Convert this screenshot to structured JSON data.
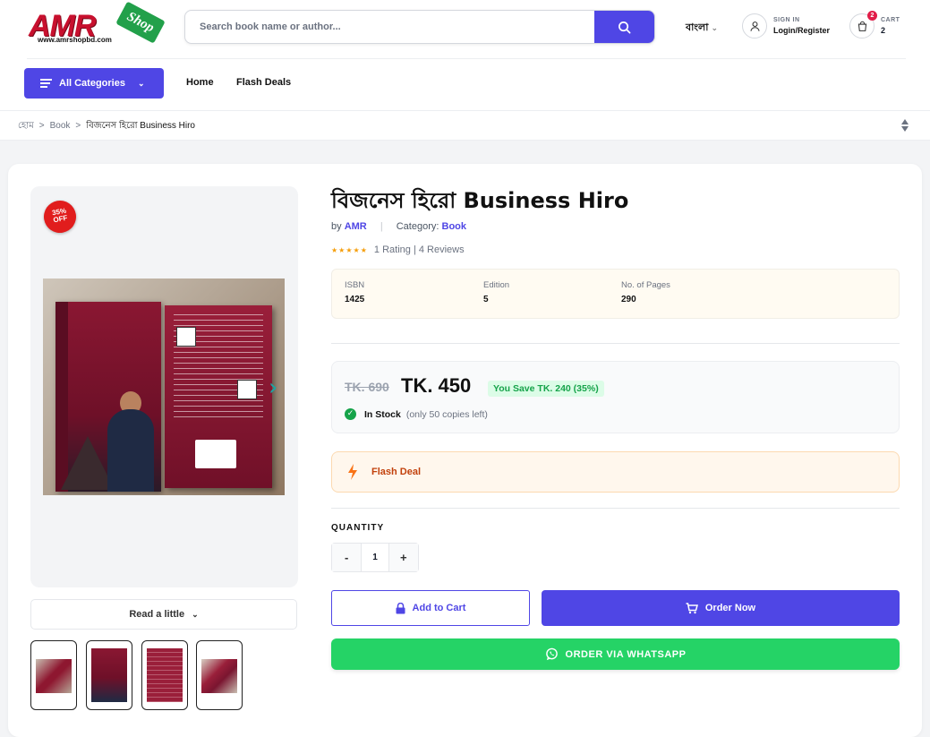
{
  "header": {
    "logo_text": "AMR",
    "logo_badge": "Shop",
    "logo_url": "www.amrshopbd.com",
    "search_placeholder": "Search book name or author...",
    "language": "বাংলা",
    "account_small": "SIGN IN",
    "account_label": "Login/Register",
    "cart_small": "CART",
    "cart_count": "2",
    "cart_badge": "2"
  },
  "nav": {
    "all_categories": "All Categories",
    "items": [
      "Home",
      "Flash Deals"
    ]
  },
  "breadcrumb": {
    "items": [
      "হোম",
      "Book",
      "বিজনেস হিরো Business Hiro"
    ],
    "separator": ">"
  },
  "product": {
    "discount_badge_line1": "35%",
    "discount_badge_line2": "OFF",
    "read_little": "Read a little",
    "title": "বিজনেস হিরো Business Hiro",
    "by_label": "by",
    "author": "AMR",
    "category_label": "Category:",
    "category": "Book",
    "stars": "★★★★★",
    "rating_text": "1 Rating | 4 Reviews",
    "specs": [
      {
        "key": "ISBN",
        "value": "1425"
      },
      {
        "key": "Edition",
        "value": "5"
      },
      {
        "key": "No. of Pages",
        "value": "290"
      }
    ],
    "old_price": "TK. 690",
    "new_price": "TK. 450",
    "save_text": "You Save TK. 240 (35%)",
    "stock_status": "In Stock",
    "stock_note": "(only 50 copies left)",
    "flash_label": "Flash Deal",
    "quantity_label": "QUANTITY",
    "quantity_value": "1",
    "qty_minus": "-",
    "qty_plus": "+",
    "add_to_cart": "Add to Cart",
    "order_now": "Order Now",
    "whatsapp": "ORDER VIA WHATSAPP"
  },
  "colors": {
    "primary": "#4f46e5",
    "whatsapp": "#25d366",
    "discount": "#e11d1d",
    "flash": "#c2410c",
    "success": "#16a34a"
  }
}
